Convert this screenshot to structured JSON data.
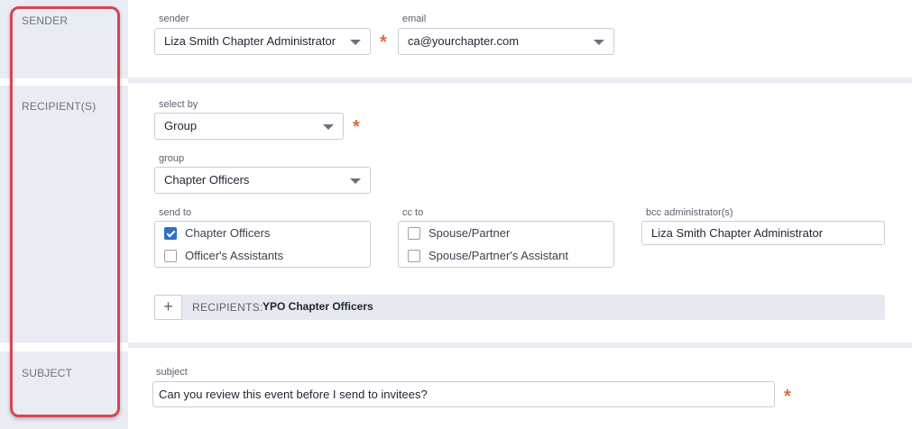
{
  "sections": {
    "sender": "SENDER",
    "recipients": "RECIPIENT(S)",
    "subject": "SUBJECT"
  },
  "sender": {
    "sender_label": "sender",
    "sender_value": "Liza Smith Chapter Administrator",
    "email_label": "email",
    "email_value": "ca@yourchapter.com",
    "required_mark": "*"
  },
  "recipients": {
    "select_by_label": "select by",
    "select_by_value": "Group",
    "group_label": "group",
    "group_value": "Chapter Officers",
    "send_to_label": "send to",
    "send_to_options": [
      {
        "label": "Chapter Officers",
        "checked": true
      },
      {
        "label": "Officer's Assistants",
        "checked": false
      }
    ],
    "cc_to_label": "cc to",
    "cc_to_options": [
      {
        "label": "Spouse/Partner",
        "checked": false
      },
      {
        "label": "Spouse/Partner's Assistant",
        "checked": false
      }
    ],
    "bcc_label": "bcc administrator(s)",
    "bcc_value": "Liza Smith Chapter Administrator",
    "add_button": "+",
    "summary_label": "RECIPIENTS:",
    "summary_value": "YPO Chapter Officers"
  },
  "subject": {
    "subject_label": "subject",
    "subject_value": "Can you review this event before I send to invitees?"
  },
  "colors": {
    "label_bg": "#e9edf3",
    "required": "#e2683c",
    "annotation": "#d64552",
    "checked": "#2f6fc4"
  }
}
